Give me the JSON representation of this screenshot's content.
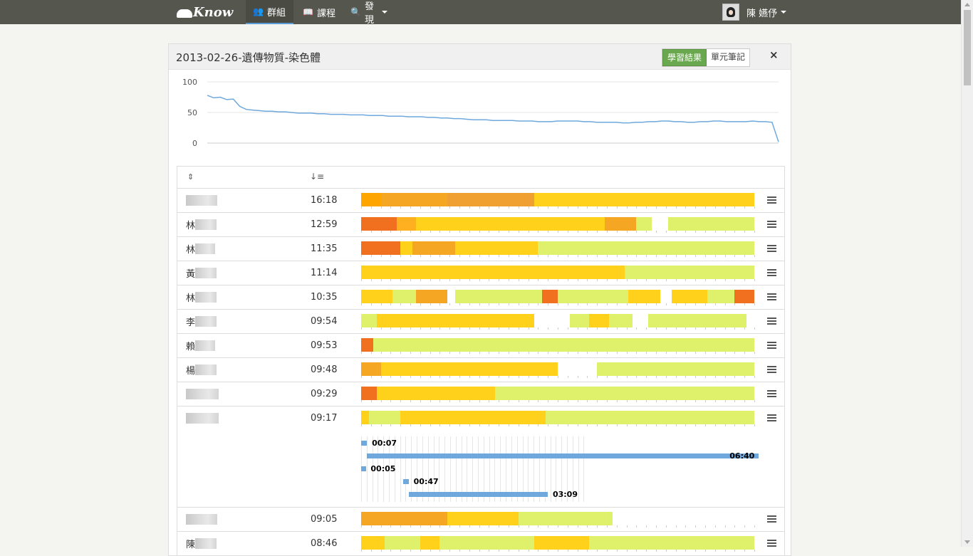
{
  "nav": {
    "brand": "Know",
    "items": [
      {
        "label": "群組",
        "icon": "users-icon",
        "glyph": "👥",
        "active": true
      },
      {
        "label": "課程",
        "icon": "book-icon",
        "glyph": "📖",
        "active": false
      },
      {
        "label": "發現",
        "icon": "search-icon",
        "glyph": "🔍",
        "active": false
      }
    ],
    "user_name": "陳 嬿伃"
  },
  "panel": {
    "title": "2013-02-26-遺傳物質-染色體",
    "tab_results": "學習結果",
    "tab_notes": "單元筆記",
    "close_glyph": "×"
  },
  "summary_chart": {
    "type": "line",
    "y_ticks": [
      "100",
      "50",
      "0"
    ],
    "ylim": [
      0,
      100
    ],
    "color": "#6fa8dc",
    "series": [
      78,
      74,
      75,
      71,
      72,
      60,
      55,
      54,
      53,
      52,
      52,
      51,
      51,
      50,
      49,
      49,
      49,
      48,
      48,
      47,
      47,
      47,
      46,
      46,
      46,
      45,
      45,
      45,
      44,
      44,
      44,
      43,
      43,
      43,
      42,
      42,
      41,
      41,
      40,
      40,
      39,
      38,
      38,
      38,
      37,
      37,
      37,
      37,
      36,
      36,
      36,
      35,
      35,
      35,
      36,
      36,
      36,
      36,
      35,
      35,
      34,
      34,
      34,
      34,
      33,
      33,
      34,
      34,
      35,
      35,
      36,
      36,
      35,
      35,
      34,
      34,
      35,
      35,
      36,
      36,
      35,
      35,
      35,
      35,
      36,
      35,
      35,
      34,
      2
    ]
  },
  "table": {
    "sort_glyph": "⇕",
    "sort_time_glyph": "↓≡",
    "rows": [
      {
        "prefix": "",
        "time": "16:18",
        "segments": [
          [
            0,
            5,
            "#ffa500"
          ],
          [
            5,
            22,
            "#f5a623"
          ],
          [
            22,
            44,
            "#f0a030"
          ],
          [
            44,
            100,
            "#ffd11a"
          ]
        ]
      },
      {
        "prefix": "林",
        "time": "12:59",
        "segments": [
          [
            0,
            9,
            "#f07020"
          ],
          [
            9,
            14,
            "#ffb020"
          ],
          [
            14,
            62,
            "#ffd11a"
          ],
          [
            62,
            70,
            "#f5a623"
          ],
          [
            70,
            74,
            "#dff06a"
          ],
          [
            74,
            78,
            "#ffffff"
          ],
          [
            78,
            100,
            "#dff06a"
          ]
        ]
      },
      {
        "prefix": "林",
        "time": "11:35",
        "segments": [
          [
            0,
            10,
            "#f07020"
          ],
          [
            10,
            13,
            "#ffd11a"
          ],
          [
            13,
            24,
            "#f5a623"
          ],
          [
            24,
            45,
            "#ffd11a"
          ],
          [
            45,
            100,
            "#dff06a"
          ]
        ]
      },
      {
        "prefix": "黃",
        "time": "11:14",
        "segments": [
          [
            0,
            67,
            "#ffd11a"
          ],
          [
            67,
            100,
            "#dff06a"
          ]
        ]
      },
      {
        "prefix": "林",
        "time": "10:35",
        "segments": [
          [
            0,
            8,
            "#ffd11a"
          ],
          [
            8,
            14,
            "#dff06a"
          ],
          [
            14,
            22,
            "#f5a623"
          ],
          [
            22,
            24,
            "#ffffff"
          ],
          [
            24,
            46,
            "#dff06a"
          ],
          [
            46,
            50,
            "#f07020"
          ],
          [
            50,
            68,
            "#dff06a"
          ],
          [
            68,
            76,
            "#ffd11a"
          ],
          [
            76,
            79,
            "#ffffff"
          ],
          [
            79,
            88,
            "#ffd11a"
          ],
          [
            88,
            95,
            "#dff06a"
          ],
          [
            95,
            100,
            "#f07020"
          ]
        ]
      },
      {
        "prefix": "李",
        "time": "09:54",
        "segments": [
          [
            0,
            4,
            "#dff06a"
          ],
          [
            4,
            44,
            "#ffd11a"
          ],
          [
            44,
            53,
            "#ffffff"
          ],
          [
            53,
            58,
            "#dff06a"
          ],
          [
            58,
            63,
            "#ffd11a"
          ],
          [
            63,
            69,
            "#dff06a"
          ],
          [
            69,
            73,
            "#ffffff"
          ],
          [
            73,
            98,
            "#dff06a"
          ],
          [
            98,
            100,
            "#ffffff"
          ]
        ]
      },
      {
        "prefix": "賴",
        "time": "09:53",
        "segments": [
          [
            0,
            3,
            "#f07020"
          ],
          [
            3,
            100,
            "#dff06a"
          ]
        ]
      },
      {
        "prefix": "楊",
        "time": "09:48",
        "segments": [
          [
            0,
            5,
            "#f5a623"
          ],
          [
            5,
            50,
            "#ffd11a"
          ],
          [
            50,
            60,
            "#ffffff"
          ],
          [
            60,
            100,
            "#dff06a"
          ]
        ]
      },
      {
        "prefix": "",
        "time": "09:29",
        "segments": [
          [
            0,
            4,
            "#f07020"
          ],
          [
            4,
            34,
            "#ffd11a"
          ],
          [
            34,
            100,
            "#dff06a"
          ]
        ]
      },
      {
        "prefix": "",
        "time": "09:17",
        "segments": [
          [
            0,
            2,
            "#ffd11a"
          ],
          [
            2,
            10,
            "#dff06a"
          ],
          [
            10,
            47,
            "#ffd11a"
          ],
          [
            47,
            100,
            "#dff06a"
          ]
        ],
        "expanded": true
      },
      {
        "prefix": "",
        "time": "09:05",
        "segments": [
          [
            0,
            22,
            "#f5a623"
          ],
          [
            22,
            40,
            "#ffd11a"
          ],
          [
            40,
            64,
            "#dff06a"
          ],
          [
            64,
            100,
            "#ffffff"
          ]
        ]
      },
      {
        "prefix": "陳",
        "time": "08:46",
        "segments": [
          [
            0,
            6,
            "#ffd11a"
          ],
          [
            6,
            15,
            "#dff06a"
          ],
          [
            15,
            20,
            "#ffd11a"
          ],
          [
            20,
            44,
            "#dff06a"
          ],
          [
            44,
            58,
            "#ffd11a"
          ],
          [
            58,
            100,
            "#dff06a"
          ]
        ]
      }
    ],
    "detail": [
      {
        "label": "00:07",
        "start": 0,
        "end": 1.5
      },
      {
        "label": "06:40",
        "start": 1.5,
        "end": 100
      },
      {
        "label": "00:05",
        "start": 0,
        "end": 1
      },
      {
        "label": "00:47",
        "start": 10.5,
        "end": 12
      },
      {
        "label": "03:09",
        "start": 12,
        "end": 47
      }
    ]
  }
}
